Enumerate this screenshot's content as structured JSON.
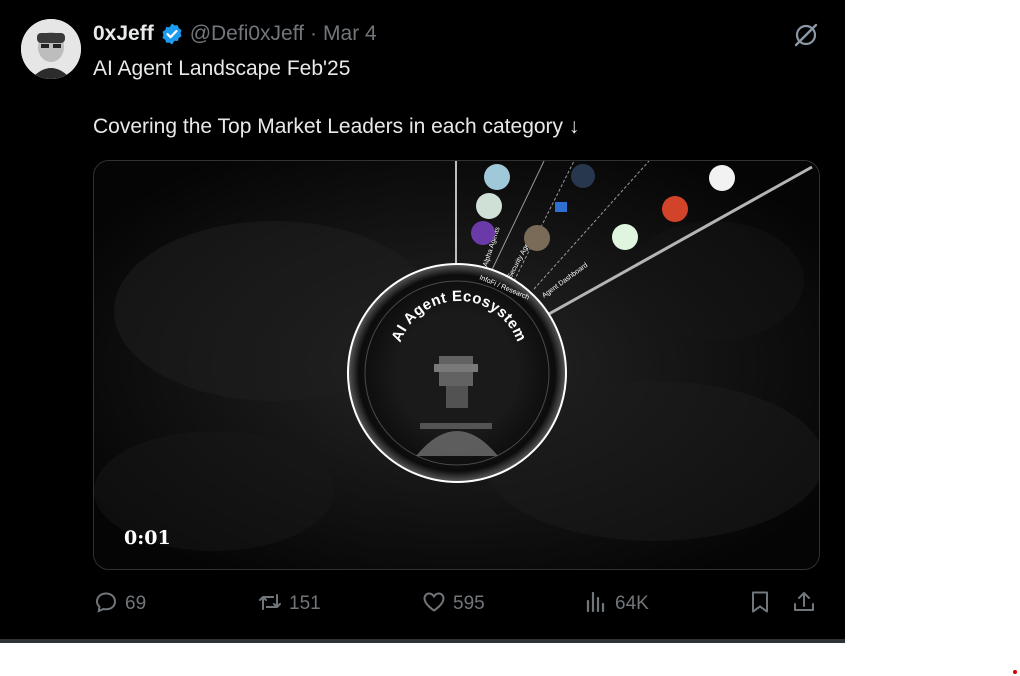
{
  "author": {
    "name": "0xJeff",
    "handle": "@Defi0xJeff",
    "separator": "·",
    "date": "Mar 4"
  },
  "tweet": {
    "line1": "AI Agent Landscape Feb'25",
    "line2": "Covering the Top Market Leaders in each category ↓"
  },
  "media": {
    "center_title": "AI Agent Ecosystem",
    "category_labels": [
      "Alpha Agents",
      "InfoFi / Research",
      "Security Agents",
      "Agent Dashboard"
    ],
    "video_time": "0:01"
  },
  "actions": {
    "replies": "69",
    "reposts": "151",
    "likes": "595",
    "views": "64K"
  },
  "colors": {
    "background": "#000000",
    "text_primary": "#e7e9ea",
    "text_secondary": "#71767b",
    "verified": "#1d9bf0"
  },
  "icons": [
    "verified-badge-icon",
    "grok-icon",
    "reply-icon",
    "repost-icon",
    "like-icon",
    "views-icon",
    "bookmark-icon",
    "share-icon"
  ]
}
